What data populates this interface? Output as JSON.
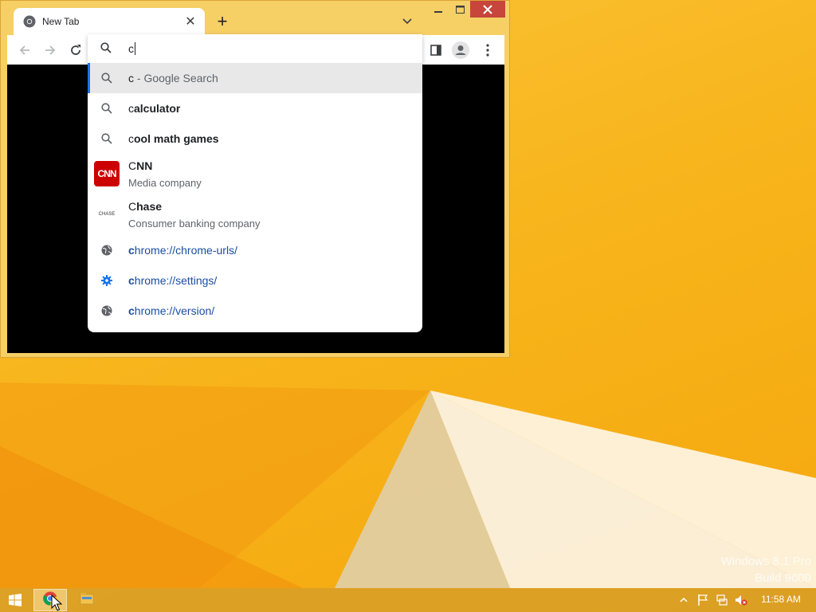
{
  "desktop": {
    "watermark_line1": "Windows 8.1 Pro",
    "watermark_line2": "Build 9600"
  },
  "browser": {
    "tab": {
      "title": "New Tab",
      "icon": "chrome-icon"
    },
    "new_tab_label": "+",
    "omnibox": {
      "value": "c",
      "suggestions": [
        {
          "icon": "search-icon",
          "typed": "c",
          "rest": " - Google Search",
          "type": "search-what-you-typed",
          "selected": true
        },
        {
          "icon": "search-icon",
          "typed": "c",
          "rest": "alculator",
          "type": "search"
        },
        {
          "icon": "search-icon",
          "typed": "c",
          "rest": "ool math games",
          "type": "search"
        },
        {
          "icon": "cnn-logo",
          "logo_text": "CNN",
          "typed": "C",
          "rest": "NN",
          "subtitle": "Media company",
          "type": "entity"
        },
        {
          "icon": "chase-logo",
          "logo_text": "CHASE",
          "typed": "C",
          "rest": "hase",
          "subtitle": "Consumer banking company",
          "type": "entity"
        },
        {
          "icon": "globe-icon",
          "typed": "c",
          "rest": "hrome://chrome-urls/",
          "type": "url"
        },
        {
          "icon": "gear-icon",
          "typed": "c",
          "rest": "hrome://settings/",
          "type": "url"
        },
        {
          "icon": "globe-icon",
          "typed": "c",
          "rest": "hrome://version/",
          "type": "url"
        }
      ]
    }
  },
  "taskbar": {
    "apps": [
      "chrome-icon",
      "file-explorer-icon"
    ],
    "tray": [
      "show-hidden-icons",
      "action-center-flag-icon",
      "network-icon",
      "volume-muted-icon"
    ],
    "clock": "11:58 AM"
  },
  "colors": {
    "accent": "#1a73e8",
    "url_text": "#1a4da1",
    "close_button": "#c7453b",
    "cnn_red": "#cc0000",
    "wallpaper": "#f7b416"
  }
}
